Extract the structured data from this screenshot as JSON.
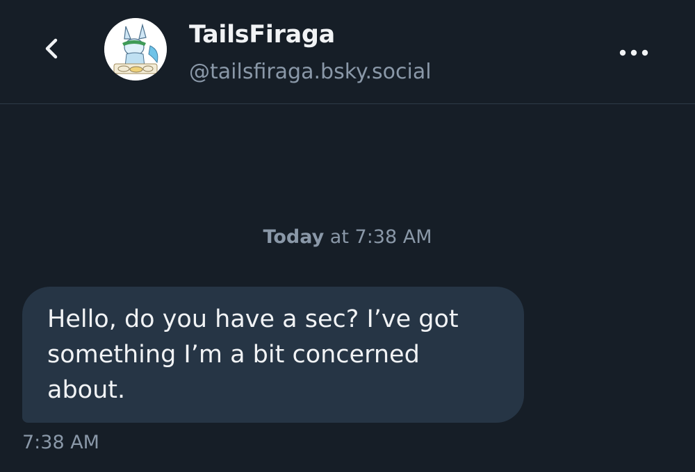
{
  "header": {
    "display_name": "TailsFiraga",
    "handle": "@tailsfiraga.bsky.social",
    "back_icon": "chevron-left-icon",
    "more_icon": "ellipsis-horizontal-icon"
  },
  "conversation": {
    "date_separator": {
      "day": "Today",
      "time": "at 7:38 AM"
    },
    "messages": [
      {
        "text": "Hello, do you have a sec? I’ve got something I’m a bit concerned about.",
        "time": "7:38 AM"
      }
    ]
  },
  "colors": {
    "background": "#161e27",
    "bubble": "#263545",
    "muted_text": "#8a98a8",
    "primary_text": "#f1f3f5",
    "divider": "#2e3a47"
  }
}
